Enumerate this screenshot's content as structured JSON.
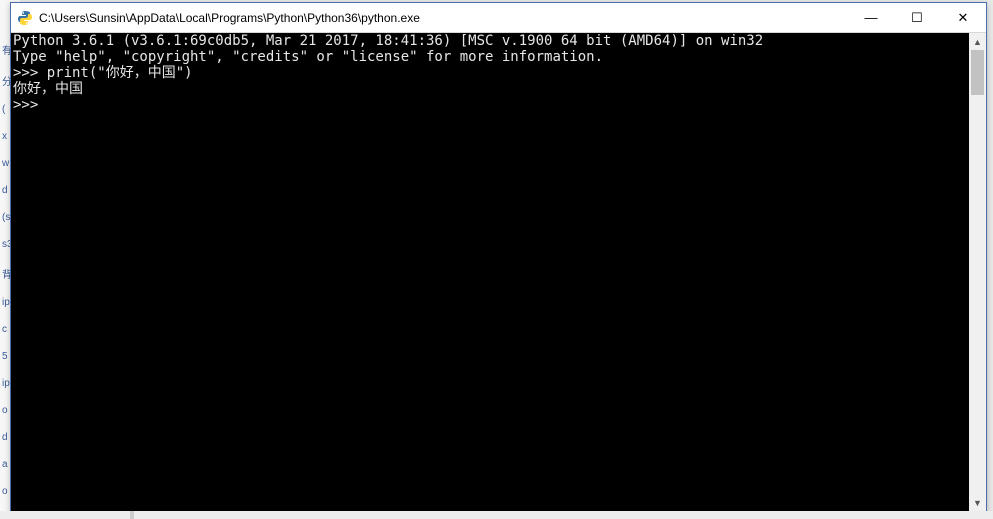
{
  "desktop": {
    "left_icons": [
      "有",
      "分",
      "(",
      "x",
      "w",
      "d",
      "(s",
      "s3",
      "背",
      "ip",
      "c",
      "5",
      "ip",
      "o",
      "d",
      "a",
      "o"
    ]
  },
  "window": {
    "title": "C:\\Users\\Sunsin\\AppData\\Local\\Programs\\Python\\Python36\\python.exe",
    "controls": {
      "minimize": "—",
      "maximize": "☐",
      "close": "✕"
    }
  },
  "terminal": {
    "lines": [
      "Python 3.6.1 (v3.6.1:69c0db5, Mar 21 2017, 18:41:36) [MSC v.1900 64 bit (AMD64)] on win32",
      "Type \"help\", \"copyright\", \"credits\" or \"license\" for more information.",
      ">>> print(\"你好，中国\")",
      "你好，中国",
      ">>> "
    ]
  },
  "scrollbar": {
    "up": "▲",
    "down": "▼"
  }
}
